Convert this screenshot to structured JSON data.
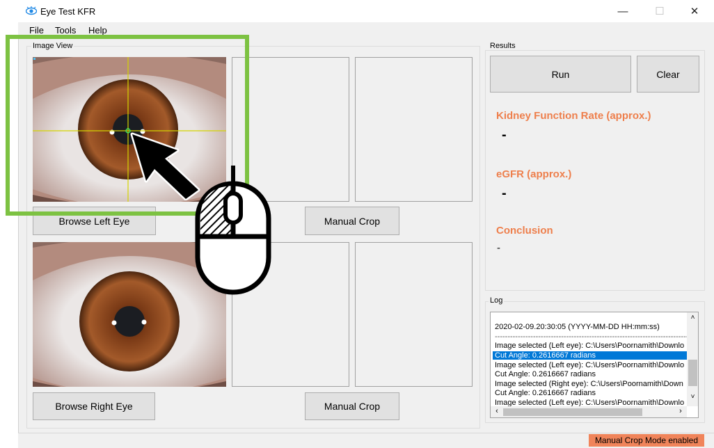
{
  "window": {
    "title": "Eye Test KFR",
    "minimize": "—",
    "maximize": "☐",
    "close": "✕"
  },
  "menu": {
    "file": "File",
    "tools": "Tools",
    "help": "Help"
  },
  "image_view": {
    "label": "Image View",
    "browse_left": "Browse Left Eye",
    "browse_right": "Browse Right Eye",
    "manual_crop_top": "Manual Crop",
    "manual_crop_bottom": "Manual Crop"
  },
  "results": {
    "label": "Results",
    "run": "Run",
    "clear": "Clear",
    "kfr_label": "Kidney Function Rate (approx.)",
    "kfr_value": "-",
    "egfr_label": "eGFR (approx.)",
    "egfr_value": "-",
    "conclusion_label": "Conclusion",
    "conclusion_value": "-"
  },
  "log": {
    "label": "Log",
    "lines": [
      "2020-02-09.20:30:05 (YYYY-MM-DD  HH:mm:ss)",
      "------------------------------------------------------------------------------",
      "Image selected (Left eye): C:\\Users\\Poornamith\\Downlo",
      "Cut Angle: 0.2616667 radians",
      "Image selected (Left eye): C:\\Users\\Poornamith\\Downlo",
      "Cut Angle: 0.2616667 radians",
      "Image selected (Right eye): C:\\Users\\Poornamith\\Down",
      "Cut Angle: 0.2616667 radians",
      "Image selected (Left eye): C:\\Users\\Poornamith\\Downlo"
    ],
    "selected_line": 3
  },
  "status": {
    "message": "Manual Crop Mode enabled"
  },
  "colors": {
    "accent": "#ee7f4c",
    "highlight_frame": "#7dc242",
    "selection": "#0078d7",
    "status_badge": "#f0845a"
  },
  "icons": {
    "app": "eye-icon",
    "pointer": "arrow-cursor-icon",
    "mouse": "mouse-left-click-icon"
  }
}
